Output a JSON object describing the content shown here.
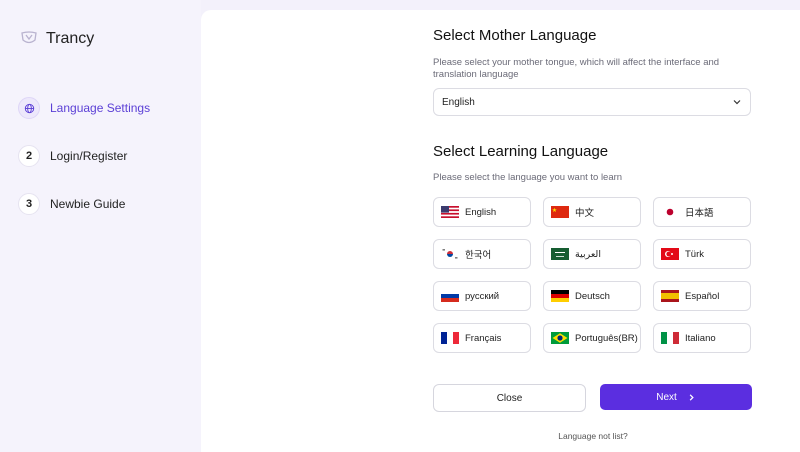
{
  "app": {
    "title": "Trancy"
  },
  "steps": [
    {
      "num": "",
      "label": "Language Settings",
      "active": true
    },
    {
      "num": "2",
      "label": "Login/Register"
    },
    {
      "num": "3",
      "label": "Newbie Guide"
    }
  ],
  "mother": {
    "heading": "Select Mother Language",
    "description": "Please select your mother tongue, which will affect the interface and translation language",
    "selected": "English"
  },
  "learning": {
    "heading": "Select Learning Language",
    "description": "Please select the language you want to learn",
    "languages": [
      {
        "label": "English",
        "flag": "us-flag-icon"
      },
      {
        "label": "中文",
        "flag": "china-flag-icon"
      },
      {
        "label": "日本語",
        "flag": "japan-flag-icon"
      },
      {
        "label": "한국어",
        "flag": "korea-flag-icon"
      },
      {
        "label": "العربية",
        "flag": "saudi-flag-icon"
      },
      {
        "label": "Türk",
        "flag": "turkey-flag-icon"
      },
      {
        "label": "русский",
        "flag": "russia-flag-icon"
      },
      {
        "label": "Deutsch",
        "flag": "germany-flag-icon"
      },
      {
        "label": "Español",
        "flag": "spain-flag-icon"
      },
      {
        "label": "Français",
        "flag": "france-flag-icon"
      },
      {
        "label": "Português(BR)",
        "flag": "brazil-flag-icon"
      },
      {
        "label": "Italiano",
        "flag": "italy-flag-icon"
      }
    ]
  },
  "actions": {
    "close": "Close",
    "next": "Next",
    "not_listed": "Language not list?"
  },
  "colors": {
    "accent": "#5b2ee0",
    "active_text": "#5b3fd6",
    "sidebar_bg": "#f5f3fc"
  }
}
